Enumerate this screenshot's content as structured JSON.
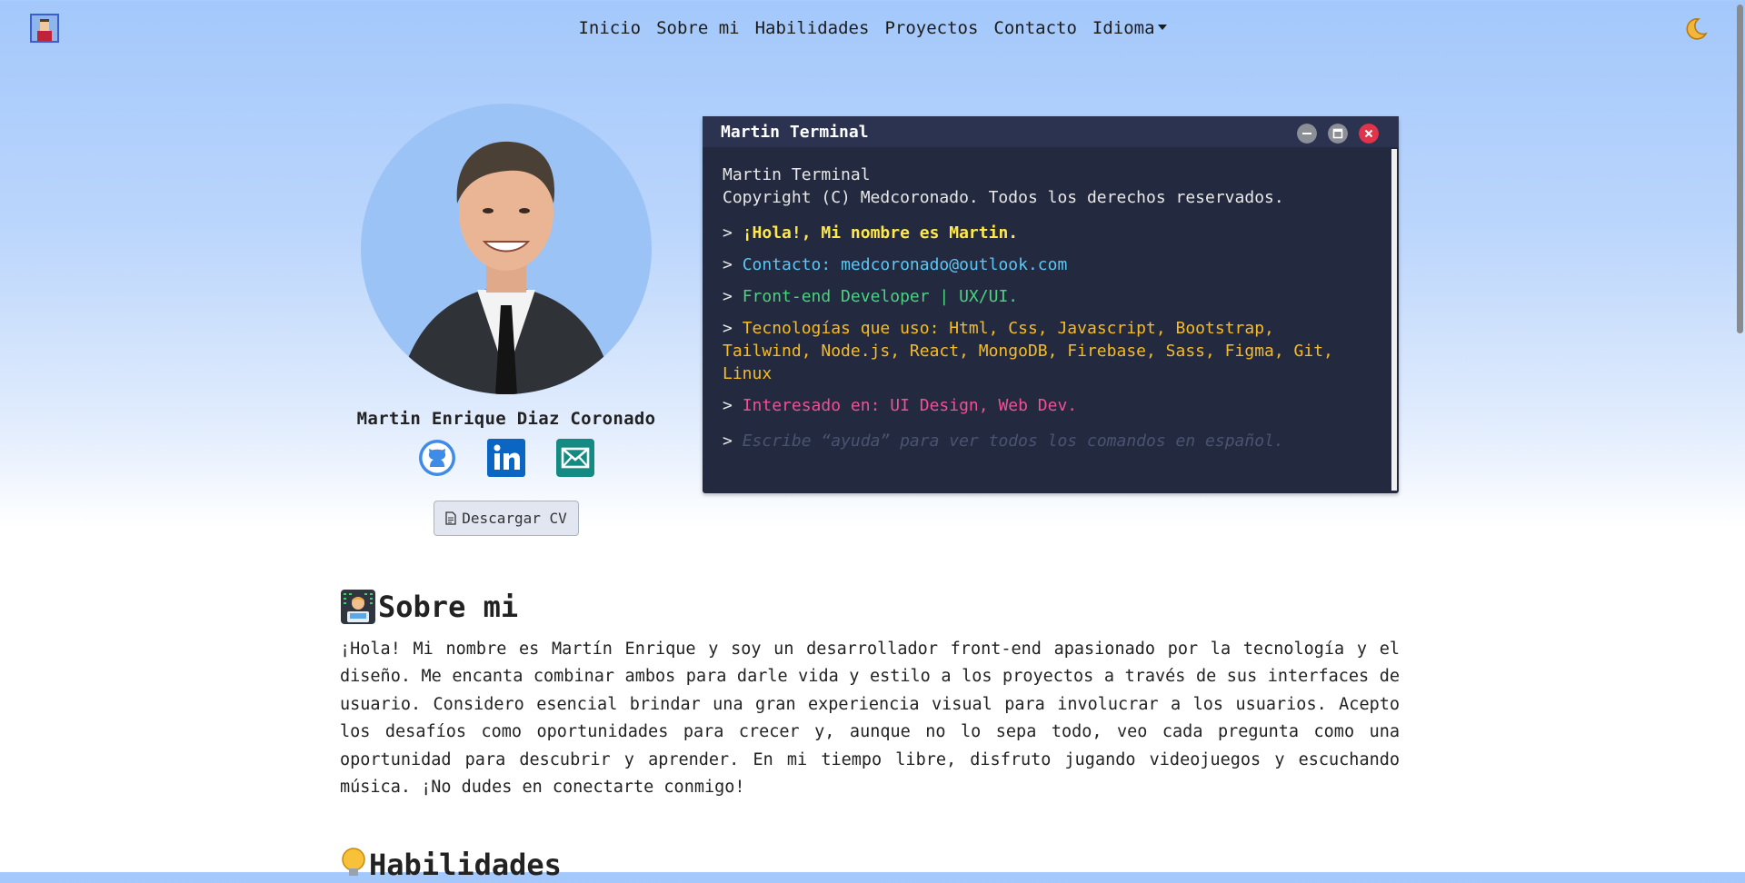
{
  "nav": {
    "links": [
      "Inicio",
      "Sobre mi",
      "Habilidades",
      "Proyectos",
      "Contacto"
    ],
    "language_menu": "Idioma",
    "theme_icon": "moon-icon"
  },
  "profile": {
    "name": "Martin Enrique Diaz Coronado",
    "socials": [
      "github-icon",
      "linkedin-icon",
      "email-icon"
    ],
    "cv_button": "Descargar CV"
  },
  "terminal": {
    "title": "Martin Terminal",
    "header_line1": "Martin Terminal",
    "header_line2": "Copyright (C) Medcoronado. Todos los derechos reservados.",
    "prompt": ">",
    "greeting": "¡Hola!, Mi nombre es Martin.",
    "contact_label": "Contacto: ",
    "contact_email": "medcoronado@outlook.com",
    "role": "Front-end Developer | UX/UI.",
    "tech": "Tecnologías que uso: Html, Css, Javascript, Bootstrap, Tailwind, Node.js, React, MongoDB, Firebase, Sass, Figma, Git, Linux",
    "interests": "Interesado en: UI Design, Web Dev.",
    "input_placeholder": "Escribe “ayuda” para ver todos los comandos en español.",
    "colors": {
      "bg": "#23293f",
      "yellow": "#ffe94a",
      "cyan": "#5cc7f5",
      "green": "#48d47c",
      "orange": "#f6bb28",
      "pink": "#f44f96"
    }
  },
  "about": {
    "title": "Sobre mi",
    "icon": "developer-emoji-icon",
    "text": "¡Hola! Mi nombre es Martín Enrique y soy un desarrollador front-end apasionado por la tecnología y el diseño. Me encanta combinar ambos para darle vida y estilo a los proyectos a través de sus interfaces de usuario. Considero esencial brindar una gran experiencia visual para involucrar a los usuarios. Acepto los desafíos como oportunidades para crecer y, aunque no lo sepa todo, veo cada pregunta como una oportunidad para descubrir y aprender. En mi tiempo libre, disfruto jugando videojuegos y escuchando música. ¡No dudes en conectarte conmigo!"
  },
  "skills": {
    "title": "Habilidades",
    "icon": "lightbulb-icon"
  }
}
